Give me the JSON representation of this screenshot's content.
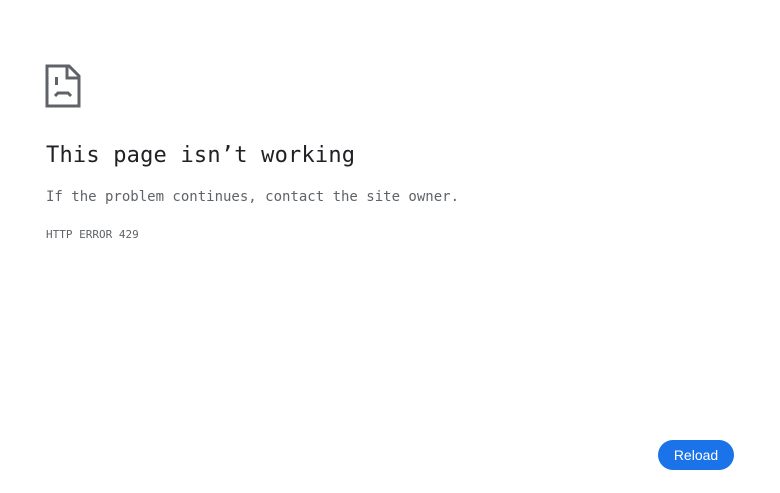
{
  "error_page": {
    "icon": "sad-page-icon",
    "title": "This page isn’t working",
    "message": "If the problem continues, contact the site owner.",
    "error_code": "HTTP ERROR 429",
    "reload_label": "Reload"
  },
  "colors": {
    "icon": "#5f6368",
    "title": "#202124",
    "text": "#5f6368",
    "button_bg": "#1a73e8",
    "button_text": "#ffffff",
    "background": "#ffffff"
  }
}
